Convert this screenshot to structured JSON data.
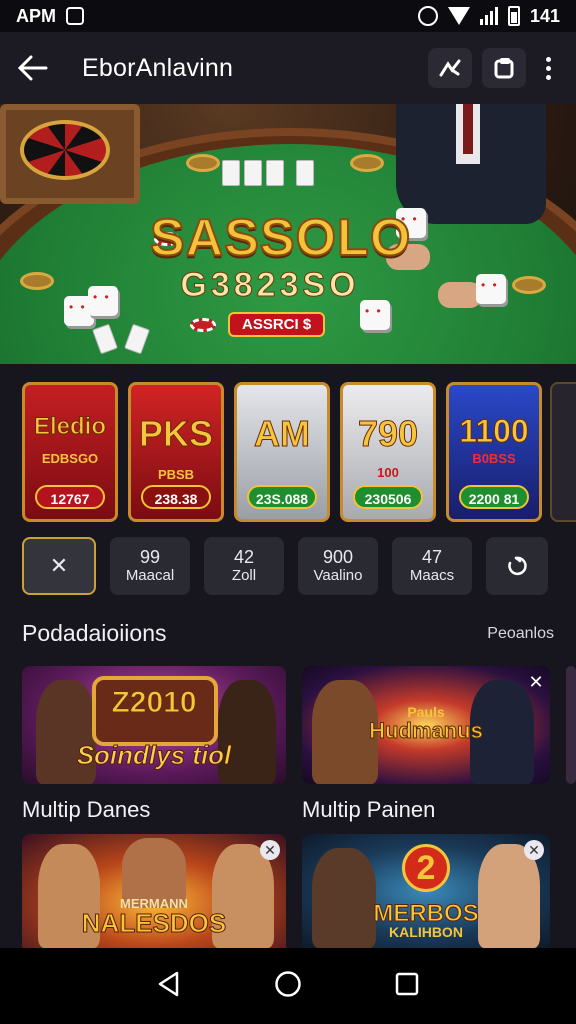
{
  "status_bar": {
    "left_text": "APM",
    "time": "141"
  },
  "app_bar": {
    "title": "EborAnlavinn"
  },
  "hero": {
    "logo_line1": "SASSOLO",
    "logo_line2": "G3823SO",
    "badge": "ASSRCI $"
  },
  "tiles": [
    {
      "title": "Eledio",
      "sub": "EDBSGO",
      "button": "12767",
      "bg": "#b3131c",
      "btn_color": "#b3131c"
    },
    {
      "title": "PKS",
      "sub": "PBSB",
      "button": "238.38",
      "bg": "#c31a1a",
      "btn_color": "#8a1010"
    },
    {
      "title": "AM",
      "sub": "",
      "button": "23S.088",
      "bg": "#cfd2d8",
      "btn_color": "#1e8e2e"
    },
    {
      "title": "790",
      "sub": "100",
      "button": "230506",
      "bg": "#d8d9dc",
      "btn_color": "#1e8e2e"
    },
    {
      "title": "1100",
      "sub": "B0BSS",
      "button": "2200 81",
      "bg": "#1f34a3",
      "btn_color": "#1e8e2e"
    }
  ],
  "stats": [
    {
      "value": "99",
      "label": "Maacal"
    },
    {
      "value": "42",
      "label": "Zoll"
    },
    {
      "value": "900",
      "label": "Vaalino"
    },
    {
      "value": "47",
      "label": "Maacs"
    }
  ],
  "section": {
    "title": "Podadaioiions",
    "link": "Peoanlos"
  },
  "promos": [
    {
      "title": "Soindlys tiol",
      "sub": "Z2010",
      "label": "Multip Danes"
    },
    {
      "title": "Hudmanus",
      "sub": "Pauls",
      "label": "Multip Painen"
    },
    {
      "title": "NALESDOS",
      "sub": "MERMANN",
      "label": ""
    },
    {
      "title": "MERBOS",
      "sub": "KALIHBON",
      "label": ""
    }
  ],
  "colors": {
    "background": "#17161e",
    "gold": "#f4c33a",
    "felt": "#1f7d34",
    "accent_red": "#c3121e"
  }
}
